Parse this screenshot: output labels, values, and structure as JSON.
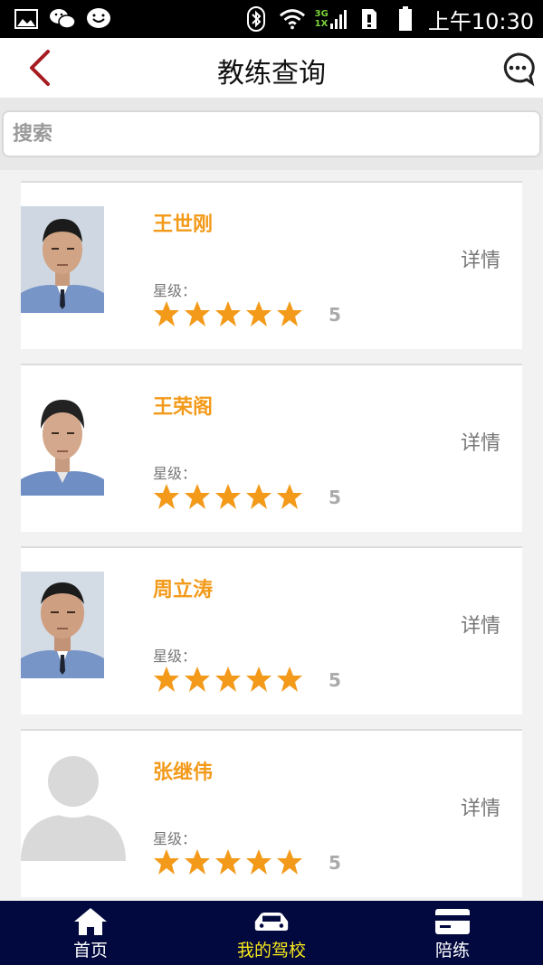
{
  "status_bar": {
    "time": "上午10:30",
    "network": "3G",
    "network_sub": "1X",
    "icons": [
      "image-icon",
      "wechat-icon",
      "chat-bubble-icon",
      "bluetooth-icon",
      "wifi-icon",
      "signal-icon",
      "sim-icon",
      "battery-icon"
    ]
  },
  "nav": {
    "title": "教练查询",
    "back_icon": "chevron-left-icon",
    "chat_icon": "chat-bubble-icon"
  },
  "search": {
    "placeholder": "搜索"
  },
  "coaches": [
    {
      "name": "王世刚",
      "rating_label": "星级：",
      "rating": "5",
      "stars": 5,
      "detail": "详情",
      "photo": "coach-photo"
    },
    {
      "name": "王荣阁",
      "rating_label": "星级：",
      "rating": "5",
      "stars": 5,
      "detail": "详情",
      "photo": "coach-photo"
    },
    {
      "name": "周立涛",
      "rating_label": "星级：",
      "rating": "5",
      "stars": 5,
      "detail": "详情",
      "photo": "coach-photo"
    },
    {
      "name": "张继伟",
      "rating_label": "星级：",
      "rating": "5",
      "stars": 5,
      "detail": "详情",
      "photo": "default-avatar"
    }
  ],
  "tabs": [
    {
      "label": "首页",
      "icon": "home-icon",
      "active": false
    },
    {
      "label": "我的驾校",
      "icon": "car-icon",
      "active": true
    },
    {
      "label": "陪练",
      "icon": "card-icon",
      "active": false
    }
  ],
  "colors": {
    "accent_orange": "#f39a1a",
    "back_red": "#a51c22",
    "tab_bar_bg": "#02093f",
    "tab_active": "#f6e81b"
  }
}
